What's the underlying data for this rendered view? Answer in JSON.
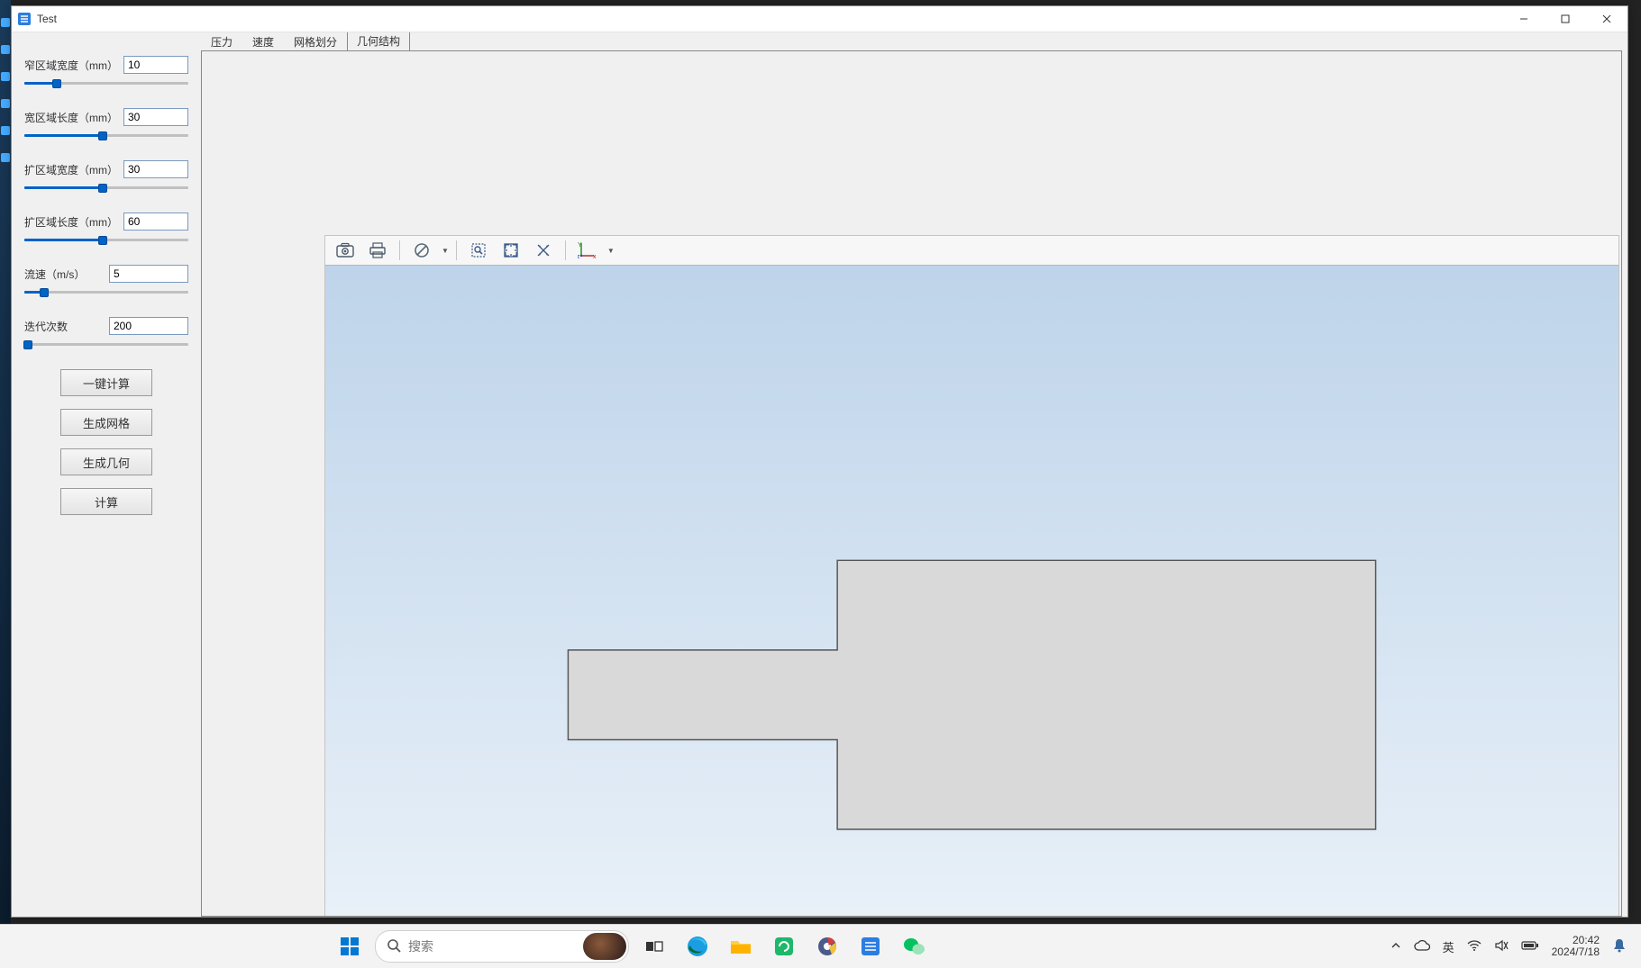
{
  "window": {
    "title": "Test"
  },
  "params": [
    {
      "label": "窄区域宽度（mm）",
      "value": "10",
      "pct": 20
    },
    {
      "label": "宽区域长度（mm）",
      "value": "30",
      "pct": 48
    },
    {
      "label": "扩区域宽度（mm）",
      "value": "30",
      "pct": 48
    },
    {
      "label": "扩区域长度（mm）",
      "value": "60",
      "pct": 48
    },
    {
      "label": "流速（m/s）",
      "value": "5",
      "pct": 12
    },
    {
      "label": "迭代次数",
      "value": "200",
      "pct": 2
    }
  ],
  "buttons": {
    "calc_all": "一键计算",
    "gen_mesh": "生成网格",
    "gen_geom": "生成几何",
    "calc": "计算"
  },
  "tabs": [
    "压力",
    "速度",
    "网格划分",
    "几何结构"
  ],
  "active_tab_index": 3,
  "viewer_toolbar": {
    "screenshot": "screenshot-icon",
    "print": "print-icon",
    "forbid": "forbid-icon",
    "zoom_box": "zoom-box-icon",
    "fit": "fit-view-icon",
    "cross": "cross-arrows-icon",
    "axes": "axes-icon"
  },
  "taskbar": {
    "search_placeholder": "搜索",
    "ime": "英",
    "time": "20:42",
    "date": "2024/7/18"
  }
}
